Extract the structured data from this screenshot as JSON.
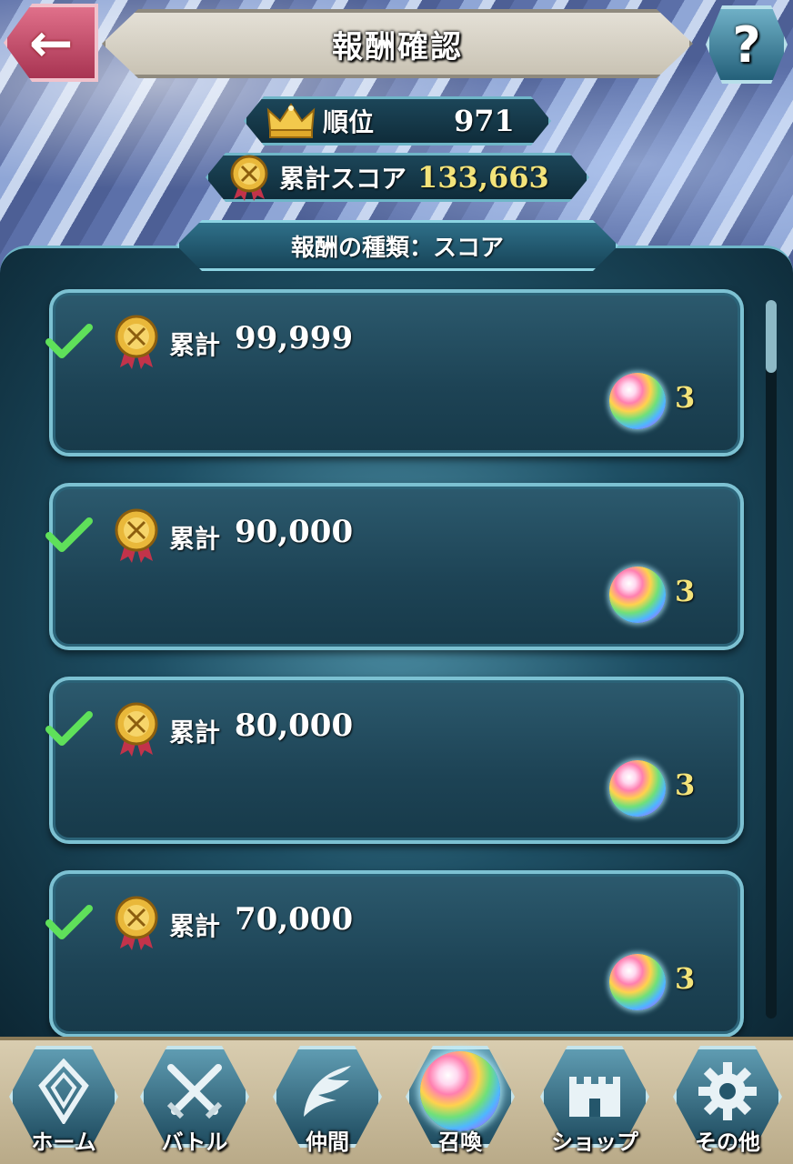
{
  "header": {
    "title": "報酬確認",
    "back_icon": "back-arrow-icon",
    "help_label": "?"
  },
  "stats": {
    "rank_label": "順位",
    "rank_value": "971",
    "score_label": "累計スコア",
    "score_value": "133,663"
  },
  "reward_type": "報酬の種類：スコア",
  "rewards": [
    {
      "label": "累計",
      "score": "99,999",
      "count": "3",
      "claimed": true
    },
    {
      "label": "累計",
      "score": "90,000",
      "count": "3",
      "claimed": true
    },
    {
      "label": "累計",
      "score": "80,000",
      "count": "3",
      "claimed": true
    },
    {
      "label": "累計",
      "score": "70,000",
      "count": "3",
      "claimed": true
    }
  ],
  "nav": [
    {
      "label": "ホーム",
      "icon": "home-crest-icon"
    },
    {
      "label": "バトル",
      "icon": "crossed-swords-icon"
    },
    {
      "label": "仲間",
      "icon": "wing-icon"
    },
    {
      "label": "召喚",
      "icon": "orb-icon"
    },
    {
      "label": "ショップ",
      "icon": "castle-icon"
    },
    {
      "label": "その他",
      "icon": "gear-icon"
    }
  ],
  "colors": {
    "gold": "#f3e37a",
    "check_green": "#5fe05a",
    "panel_border": "#7cc1d2"
  }
}
